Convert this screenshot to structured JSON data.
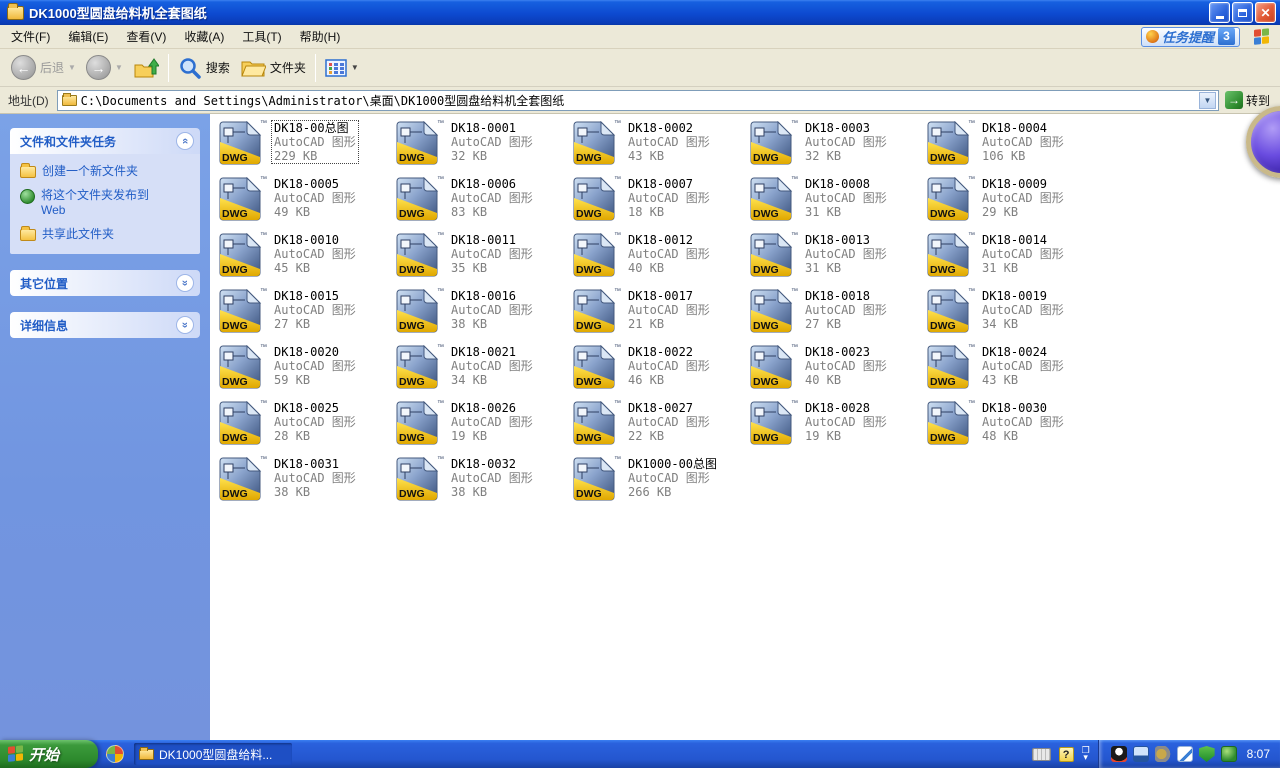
{
  "window": {
    "title": "DK1000型圆盘给料机全套图纸"
  },
  "menu_bar": {
    "items": [
      "文件(F)",
      "编辑(E)",
      "查看(V)",
      "收藏(A)",
      "工具(T)",
      "帮助(H)"
    ],
    "task_reminder": {
      "label": "任务提醒",
      "count": "3"
    }
  },
  "toolbar": {
    "back_label": "后退",
    "search_label": "搜索",
    "folders_label": "文件夹"
  },
  "address_bar": {
    "label": "地址(D)",
    "path": "C:\\Documents and Settings\\Administrator\\桌面\\DK1000型圆盘给料机全套图纸",
    "go_label": "转到"
  },
  "sidebar": {
    "panels": {
      "tasks": {
        "title": "文件和文件夹任务",
        "links": [
          {
            "label": "创建一个新文件夹",
            "icon": "icon-new-folder"
          },
          {
            "label": "将这个文件夹发布到 Web",
            "icon": "icon-publish-web"
          },
          {
            "label": "共享此文件夹",
            "icon": "icon-share-folder"
          }
        ]
      },
      "other_places": {
        "title": "其它位置"
      },
      "details": {
        "title": "详细信息"
      }
    }
  },
  "files": {
    "type_label": "AutoCAD 图形",
    "ext": "DWG",
    "tm": "™",
    "items": [
      {
        "name": "DK18-00总图",
        "size": "229 KB",
        "selected": true
      },
      {
        "name": "DK18-0001",
        "size": "32 KB"
      },
      {
        "name": "DK18-0002",
        "size": "43 KB"
      },
      {
        "name": "DK18-0003",
        "size": "32 KB"
      },
      {
        "name": "DK18-0004",
        "size": "106 KB"
      },
      {
        "name": "DK18-0005",
        "size": "49 KB"
      },
      {
        "name": "DK18-0006",
        "size": "83 KB"
      },
      {
        "name": "DK18-0007",
        "size": "18 KB"
      },
      {
        "name": "DK18-0008",
        "size": "31 KB"
      },
      {
        "name": "DK18-0009",
        "size": "29 KB"
      },
      {
        "name": "DK18-0010",
        "size": "45 KB"
      },
      {
        "name": "DK18-0011",
        "size": "35 KB"
      },
      {
        "name": "DK18-0012",
        "size": "40 KB"
      },
      {
        "name": "DK18-0013",
        "size": "31 KB"
      },
      {
        "name": "DK18-0014",
        "size": "31 KB"
      },
      {
        "name": "DK18-0015",
        "size": "27 KB"
      },
      {
        "name": "DK18-0016",
        "size": "38 KB"
      },
      {
        "name": "DK18-0017",
        "size": "21 KB"
      },
      {
        "name": "DK18-0018",
        "size": "27 KB"
      },
      {
        "name": "DK18-0019",
        "size": "34 KB"
      },
      {
        "name": "DK18-0020",
        "size": "59 KB"
      },
      {
        "name": "DK18-0021",
        "size": "34 KB"
      },
      {
        "name": "DK18-0022",
        "size": "46 KB"
      },
      {
        "name": "DK18-0023",
        "size": "40 KB"
      },
      {
        "name": "DK18-0024",
        "size": "43 KB"
      },
      {
        "name": "DK18-0025",
        "size": "28 KB"
      },
      {
        "name": "DK18-0026",
        "size": "19 KB"
      },
      {
        "name": "DK18-0027",
        "size": "22 KB"
      },
      {
        "name": "DK18-0028",
        "size": "19 KB"
      },
      {
        "name": "DK18-0030",
        "size": "48 KB"
      },
      {
        "name": "DK18-0031",
        "size": "38 KB"
      },
      {
        "name": "DK18-0032",
        "size": "38 KB"
      },
      {
        "name": "DK1000-00总图",
        "size": "266 KB"
      }
    ]
  },
  "taskbar": {
    "start_label": "开始",
    "task_button_label": "DK1000型圆盘给料...",
    "clock": "8:07"
  },
  "colors": {
    "titlebar_blue": "#0d4ad0",
    "xp_beige": "#ece9d8",
    "sidebar_blue": "#7ba2e7",
    "panel_body": "#d6dff7",
    "link_blue": "#215dc6",
    "taskbar_blue": "#2456cf",
    "start_green": "#2d8a2d",
    "dwg_gold": "#e8b800"
  }
}
